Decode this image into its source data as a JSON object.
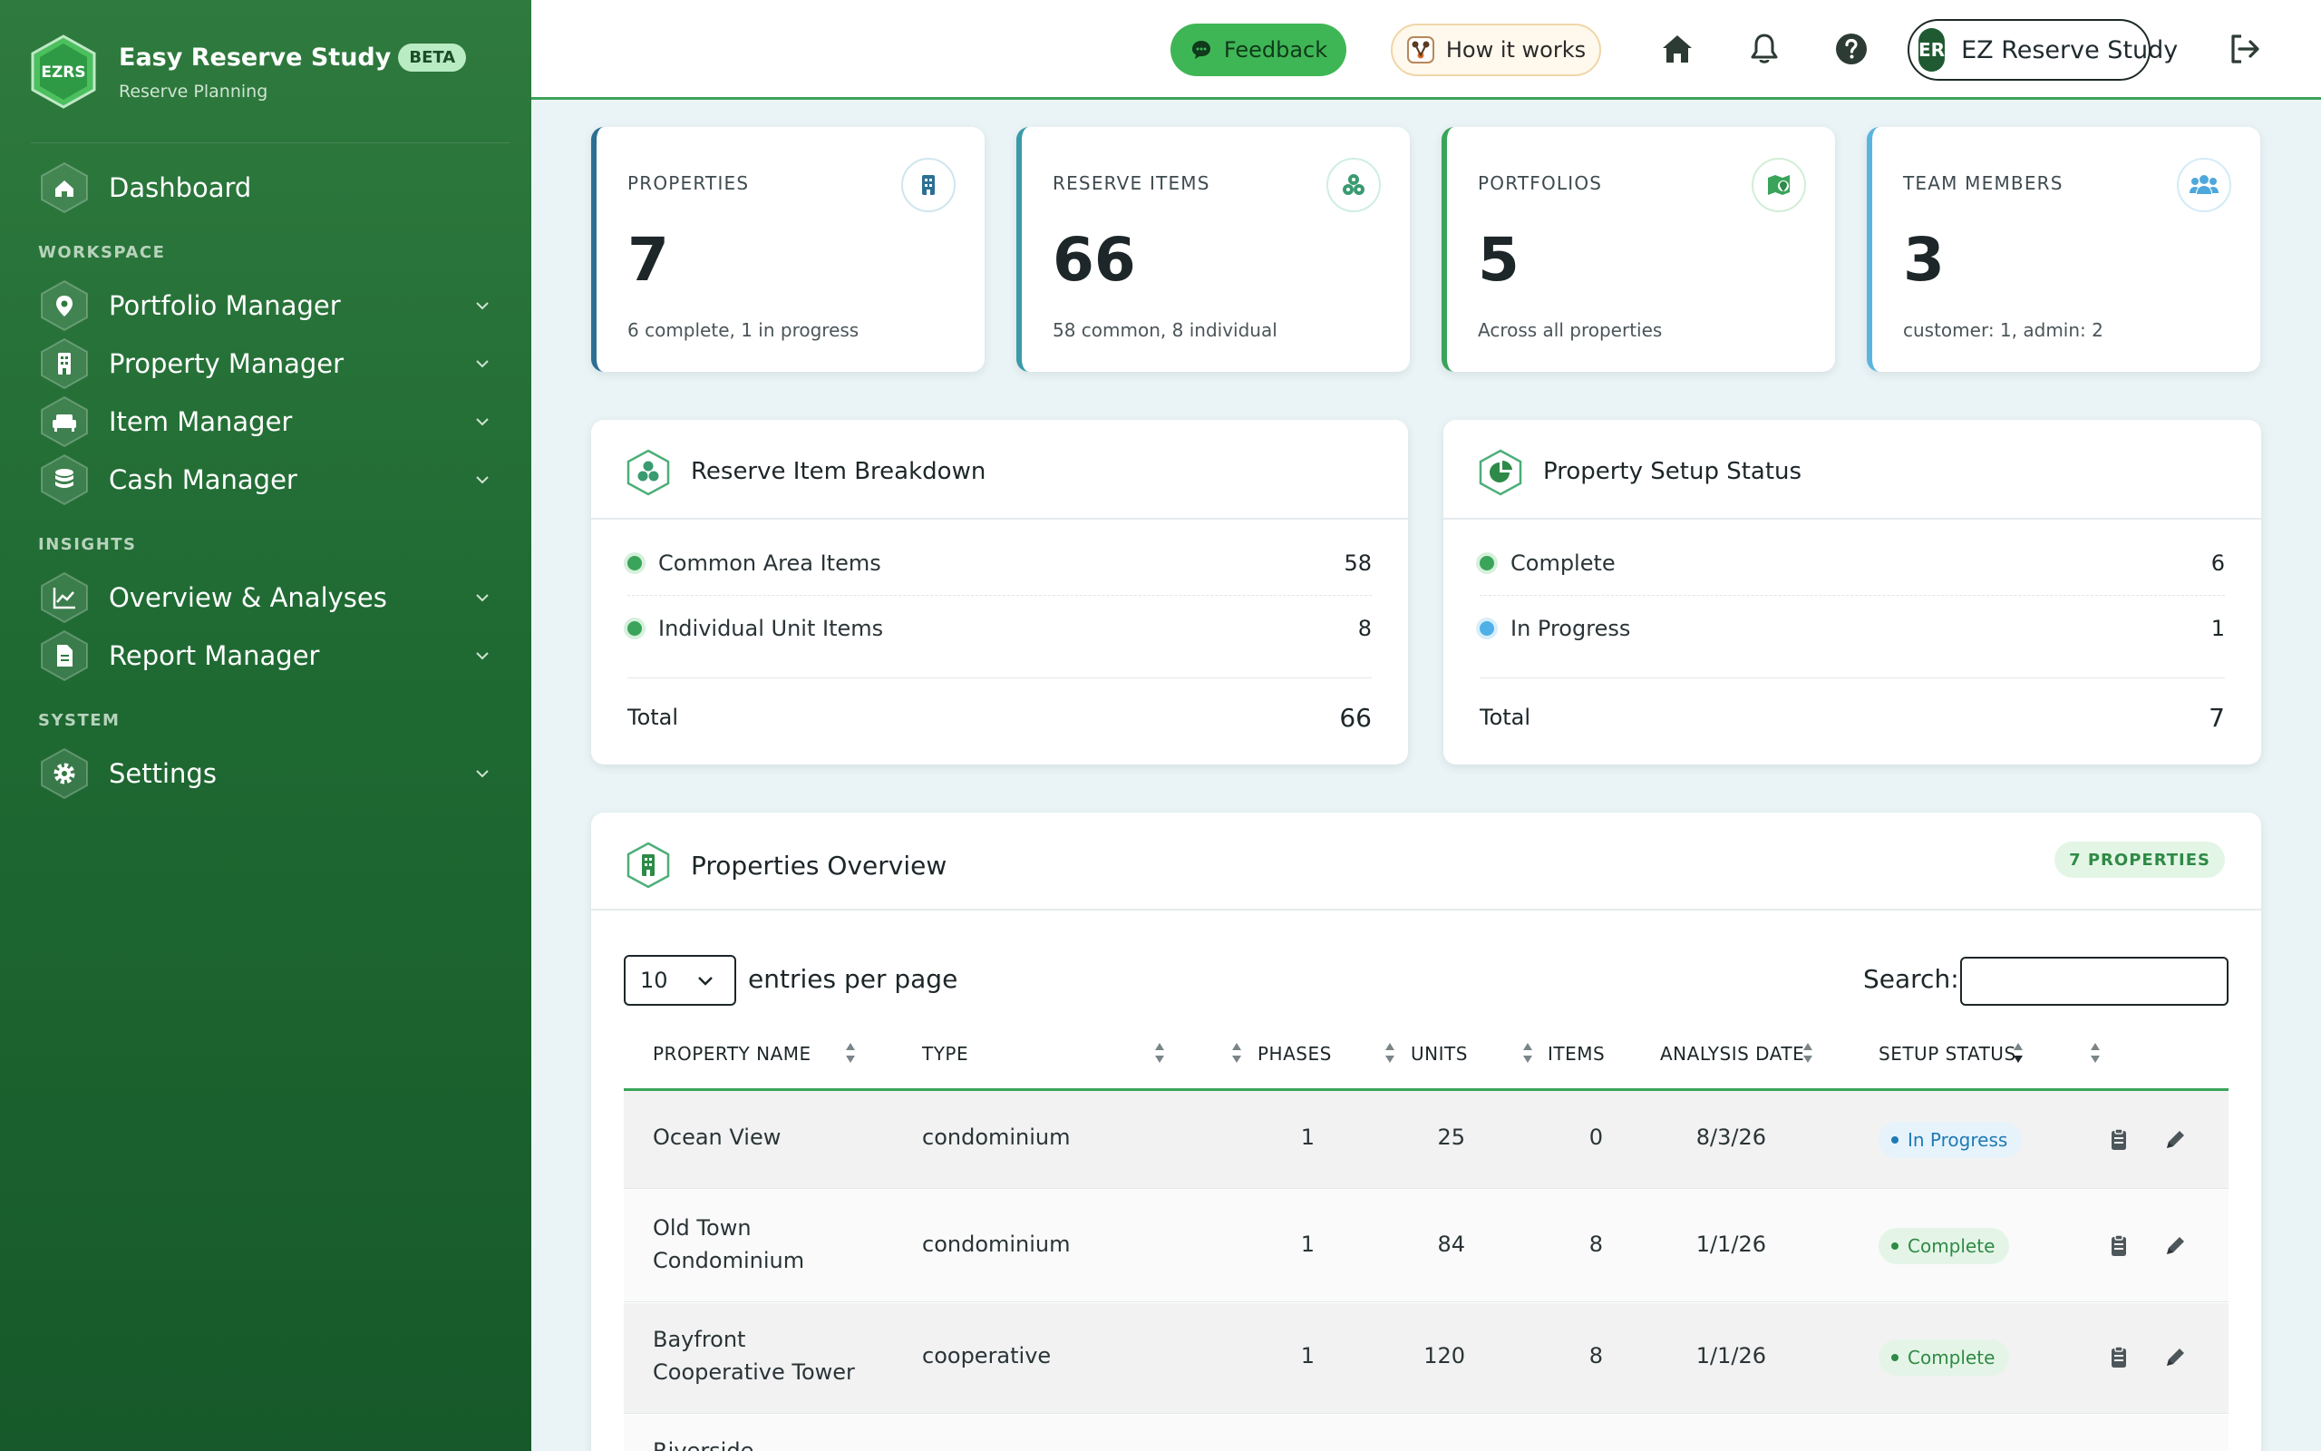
{
  "app": {
    "logo_text": "EZRS",
    "name": "Easy Reserve Study",
    "badge": "BETA",
    "tagline": "Reserve Planning"
  },
  "sidebar": {
    "dashboard": "Dashboard",
    "sections": {
      "workspace": "WORKSPACE",
      "insights": "INSIGHTS",
      "system": "SYSTEM"
    },
    "workspace_items": [
      "Portfolio Manager",
      "Property Manager",
      "Item Manager",
      "Cash Manager"
    ],
    "insights_items": [
      "Overview & Analyses",
      "Report Manager"
    ],
    "system_items": [
      "Settings"
    ]
  },
  "topbar": {
    "feedback": "Feedback",
    "how_it_works": "How it works",
    "user_initials": "ER",
    "user_name": "EZ Reserve Study"
  },
  "stats": [
    {
      "title": "PROPERTIES",
      "value": "7",
      "sub": "6 complete, 1 in progress",
      "icon": "building-icon",
      "accent": "#2c6f93"
    },
    {
      "title": "RESERVE ITEMS",
      "value": "66",
      "sub": "58 common, 8 individual",
      "icon": "boxes-icon",
      "accent": "#3a9aa8"
    },
    {
      "title": "PORTFOLIOS",
      "value": "5",
      "sub": "Across all properties",
      "icon": "map-pin-icon",
      "accent": "#3aa45a"
    },
    {
      "title": "TEAM MEMBERS",
      "value": "3",
      "sub": "customer: 1, admin: 2",
      "icon": "users-icon",
      "accent": "#5bb4e0"
    }
  ],
  "breakdown": {
    "title": "Reserve Item Breakdown",
    "rows": [
      {
        "label": "Common Area Items",
        "value": "58",
        "color": "#3aa45a"
      },
      {
        "label": "Individual Unit Items",
        "value": "8",
        "color": "#3aa45a"
      }
    ],
    "total_label": "Total",
    "total_value": "66"
  },
  "setup": {
    "title": "Property Setup Status",
    "rows": [
      {
        "label": "Complete",
        "value": "6",
        "color": "#3aa45a"
      },
      {
        "label": "In Progress",
        "value": "1",
        "color": "#4fb0e8"
      }
    ],
    "total_label": "Total",
    "total_value": "7"
  },
  "overview": {
    "title": "Properties Overview",
    "count_badge": "7 PROPERTIES",
    "entries_value": "10",
    "entries_label": "entries per page",
    "search_label": "Search:",
    "search_value": "",
    "columns": [
      "PROPERTY NAME",
      "TYPE",
      "PHASES",
      "UNITS",
      "ITEMS",
      "ANALYSIS DATE",
      "SETUP STATUS"
    ],
    "rows": [
      {
        "name": "Ocean View",
        "name2": "",
        "type": "condominium",
        "phases": "1",
        "units": "25",
        "items": "0",
        "date": "8/3/26",
        "status": "In Progress"
      },
      {
        "name": "Old Town",
        "name2": "Condominium",
        "type": "condominium",
        "phases": "1",
        "units": "84",
        "items": "8",
        "date": "1/1/26",
        "status": "Complete"
      },
      {
        "name": "Bayfront",
        "name2": "Cooperative Tower",
        "type": "cooperative",
        "phases": "1",
        "units": "120",
        "items": "8",
        "date": "1/1/26",
        "status": "Complete"
      },
      {
        "name": "Riverside",
        "name2": "",
        "type": "",
        "phases": "",
        "units": "",
        "items": "",
        "date": "",
        "status": ""
      }
    ]
  }
}
